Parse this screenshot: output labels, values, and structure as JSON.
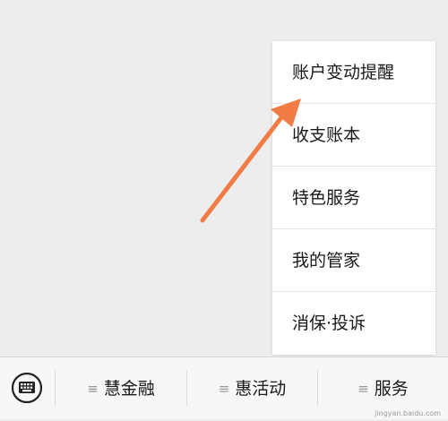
{
  "popup_menu": {
    "items": [
      {
        "label": "账户变动提醒"
      },
      {
        "label": "收支账本"
      },
      {
        "label": "特色服务"
      },
      {
        "label": "我的管家"
      },
      {
        "label": "消保·投诉"
      }
    ]
  },
  "bottom_bar": {
    "keyboard_icon": "keyboard-icon",
    "menus": [
      {
        "label": "慧金融",
        "icon": "menu-lines-icon"
      },
      {
        "label": "惠活动",
        "icon": "menu-lines-icon"
      },
      {
        "label": "服务",
        "icon": "menu-lines-icon"
      }
    ]
  },
  "annotation": {
    "arrow_color": "#f27c45"
  },
  "watermark": {
    "text": "jingyan.baidu.com"
  }
}
